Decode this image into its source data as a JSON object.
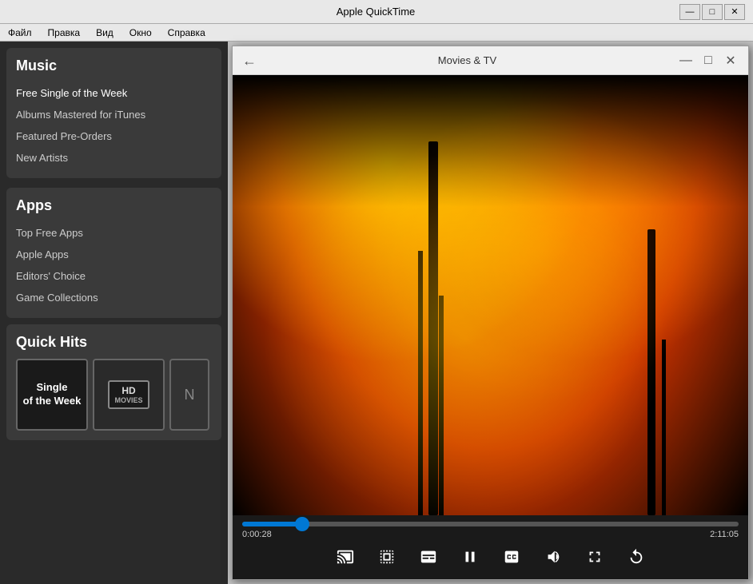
{
  "app": {
    "title": "Apple QuickTime",
    "menu_items": [
      "Файл",
      "Правка",
      "Вид",
      "Окно",
      "Справка"
    ]
  },
  "title_bar_controls": {
    "minimize": "—",
    "maximize": "□",
    "close": "✕"
  },
  "sidebar": {
    "music_section": {
      "title": "Music",
      "items": [
        {
          "label": "Free Single of the Week",
          "active": true
        },
        {
          "label": "Albums Mastered for iTunes"
        },
        {
          "label": "Featured Pre-Orders"
        },
        {
          "label": "New Artists"
        }
      ]
    },
    "apps_section": {
      "title": "Apps",
      "items": [
        {
          "label": "Top Free Apps"
        },
        {
          "label": "Apple Apps"
        },
        {
          "label": "Editors' Choice"
        },
        {
          "label": "Game Collections"
        }
      ]
    },
    "quick_hits": {
      "title": "Quick Hits",
      "item1_line1": "Single",
      "item1_line2": "of the Week",
      "item2_label": "HD MOVIES",
      "item2_badge_hd": "HD",
      "item2_badge_movies": "MOVIES"
    }
  },
  "movies_window": {
    "title": "Movies & TV",
    "back_icon": "←",
    "controls": {
      "minimize": "—",
      "maximize": "□",
      "close": "✕"
    }
  },
  "player": {
    "current_time": "0:00:28",
    "total_time": "2:11:05",
    "progress_percent": 12,
    "controls": {
      "cast": "cast",
      "chapters": "chapters",
      "text": "text",
      "play_pause": "pause",
      "cc": "cc",
      "volume": "volume",
      "fullscreen": "fullscreen",
      "replay": "replay"
    }
  }
}
